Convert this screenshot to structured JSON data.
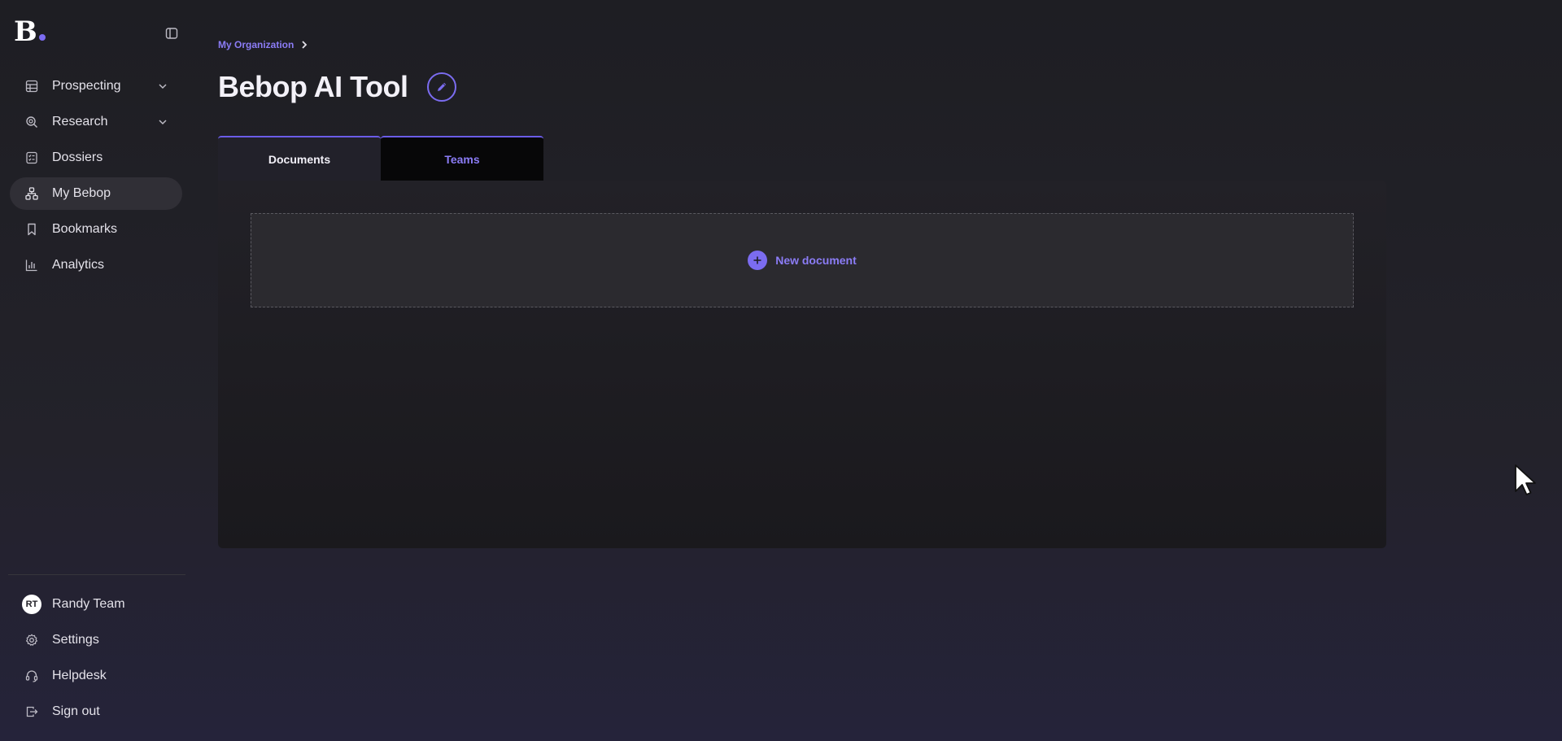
{
  "logo": {
    "letter": "B"
  },
  "sidebar": {
    "items": [
      {
        "label": "Prospecting",
        "icon": "table-icon",
        "expandable": true
      },
      {
        "label": "Research",
        "icon": "search-icon",
        "expandable": true
      },
      {
        "label": "Dossiers",
        "icon": "checklist-icon",
        "expandable": false
      },
      {
        "label": "My Bebop",
        "icon": "org-chart-icon",
        "expandable": false,
        "active": true
      },
      {
        "label": "Bookmarks",
        "icon": "bookmark-icon",
        "expandable": false
      },
      {
        "label": "Analytics",
        "icon": "bar-chart-icon",
        "expandable": false
      }
    ],
    "bottom": {
      "user": {
        "initials": "RT",
        "name": "Randy Team"
      },
      "settings": "Settings",
      "helpdesk": "Helpdesk",
      "signout": "Sign out"
    }
  },
  "breadcrumb": {
    "org": "My Organization"
  },
  "page": {
    "title": "Bebop AI Tool"
  },
  "tabs": [
    {
      "label": "Documents",
      "active": true
    },
    {
      "label": "Teams",
      "active": false
    }
  ],
  "documents": {
    "new_label": "New document"
  },
  "colors": {
    "accent": "#7b6cf0",
    "accent_text": "#8b7cf6",
    "background": "#1f1e25"
  }
}
